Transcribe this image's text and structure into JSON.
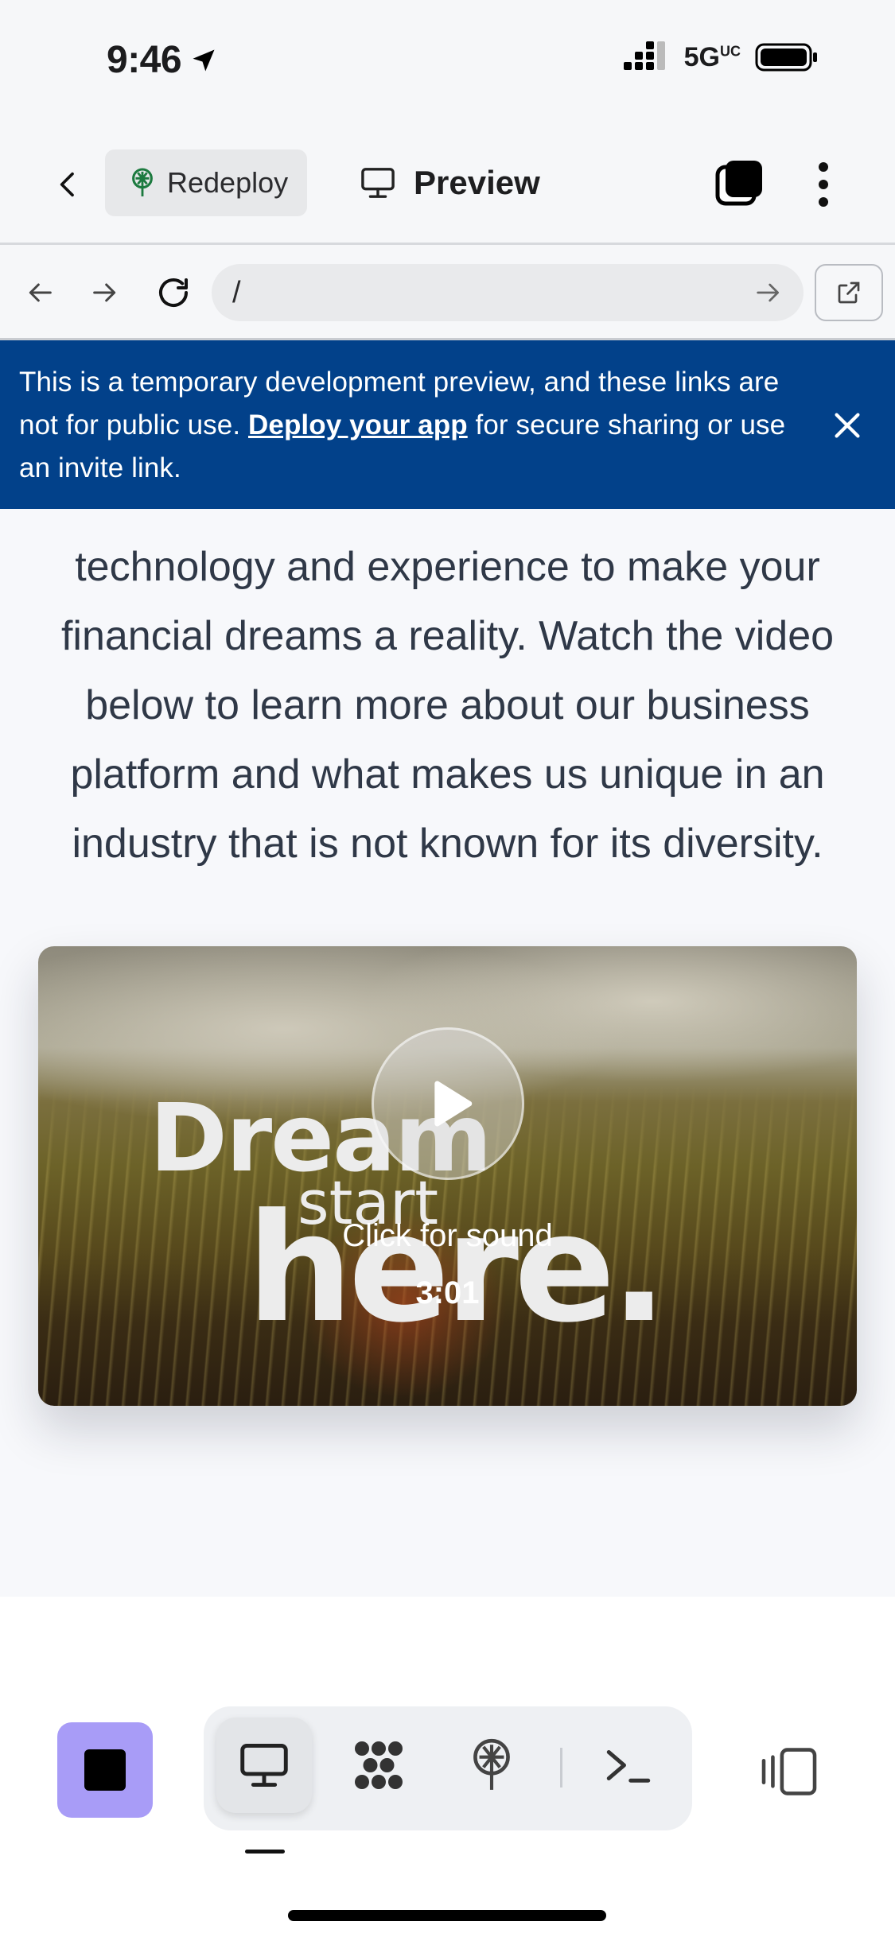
{
  "status_bar": {
    "time": "9:46",
    "network": "5G",
    "network_suffix": "UC"
  },
  "header": {
    "redeploy_label": "Redeploy",
    "preview_label": "Preview"
  },
  "browser": {
    "url": "/"
  },
  "banner": {
    "text_before": "This is a temporary development preview, and these links are not for public use. ",
    "link_text": "Deploy your app",
    "text_after": " for secure sharing or use an invite link.",
    "bg_color": "#02418a"
  },
  "page": {
    "intro": "technology and experience to make your financial dreams a reality. Watch the video below to learn more about our business platform and what makes us unique in an industry that is not known for its diversity.",
    "video": {
      "title_word1": "Dream",
      "title_word2": "start",
      "title_word3": "here.",
      "sound_label": "Click for sound",
      "duration": "3:01"
    }
  },
  "toolbar": {
    "stop_color": "#a89cf7",
    "tools": [
      "monitor-icon",
      "apps-icon",
      "deploy-icon",
      "terminal-icon"
    ]
  }
}
